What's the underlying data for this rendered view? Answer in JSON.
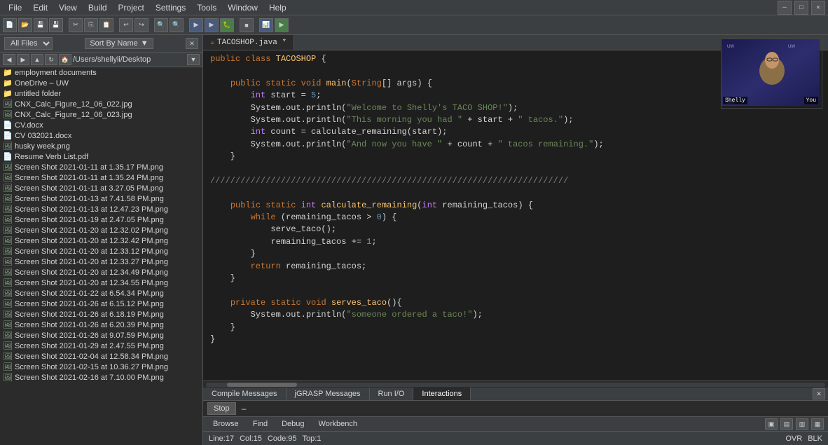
{
  "menuBar": {
    "items": [
      "File",
      "Edit",
      "View",
      "Build",
      "Project",
      "Settings",
      "Tools",
      "Window",
      "Help"
    ]
  },
  "toolbar": {
    "buttons": [
      "new",
      "open",
      "save",
      "saveall",
      "sep",
      "cut",
      "copy",
      "paste",
      "sep",
      "undo",
      "redo",
      "sep",
      "compile",
      "run",
      "debug",
      "sep",
      "stop",
      "sep",
      "browse"
    ]
  },
  "sidebar": {
    "allFilesLabel": "All Files",
    "sortByLabel": "Sort By Name",
    "path": "/Users/shellyli/Desktop",
    "files": [
      {
        "name": "employment documents",
        "type": "folder"
      },
      {
        "name": "OneDrive – UW",
        "type": "folder"
      },
      {
        "name": "untitled folder",
        "type": "folder"
      },
      {
        "name": "CNX_Calc_Figure_12_06_022.jpg",
        "type": "jpg"
      },
      {
        "name": "CNX_Calc_Figure_12_06_023.jpg",
        "type": "jpg"
      },
      {
        "name": "CV.docx",
        "type": "docx"
      },
      {
        "name": "CV 032021.docx",
        "type": "docx"
      },
      {
        "name": "husky week.png",
        "type": "png"
      },
      {
        "name": "Resume Verb List.pdf",
        "type": "pdf"
      },
      {
        "name": "Screen Shot 2021-01-11 at 1.35.17 PM.png",
        "type": "png"
      },
      {
        "name": "Screen Shot 2021-01-11 at 1.35.24 PM.png",
        "type": "png"
      },
      {
        "name": "Screen Shot 2021-01-11 at 3.27.05 PM.png",
        "type": "png"
      },
      {
        "name": "Screen Shot 2021-01-13 at 7.41.58 PM.png",
        "type": "png"
      },
      {
        "name": "Screen Shot 2021-01-13 at 12.47.23 PM.png",
        "type": "png"
      },
      {
        "name": "Screen Shot 2021-01-19 at 2.47.05 PM.png",
        "type": "png"
      },
      {
        "name": "Screen Shot 2021-01-20 at 12.32.02 PM.png",
        "type": "png"
      },
      {
        "name": "Screen Shot 2021-01-20 at 12.32.42 PM.png",
        "type": "png"
      },
      {
        "name": "Screen Shot 2021-01-20 at 12.33.12 PM.png",
        "type": "png"
      },
      {
        "name": "Screen Shot 2021-01-20 at 12.33.27 PM.png",
        "type": "png"
      },
      {
        "name": "Screen Shot 2021-01-20 at 12.34.49 PM.png",
        "type": "png"
      },
      {
        "name": "Screen Shot 2021-01-20 at 12.34.55 PM.png",
        "type": "png"
      },
      {
        "name": "Screen Shot 2021-01-22 at 6.54.34 PM.png",
        "type": "png"
      },
      {
        "name": "Screen Shot 2021-01-26 at 6.15.12 PM.png",
        "type": "png"
      },
      {
        "name": "Screen Shot 2021-01-26 at 6.18.19 PM.png",
        "type": "png"
      },
      {
        "name": "Screen Shot 2021-01-26 at 6.20.39 PM.png",
        "type": "png"
      },
      {
        "name": "Screen Shot 2021-01-26 at 9.07.59 PM.png",
        "type": "png"
      },
      {
        "name": "Screen Shot 2021-01-29 at 2.47.55 PM.png",
        "type": "png"
      },
      {
        "name": "Screen Shot 2021-02-04 at 12.58.34 PM.png",
        "type": "png"
      },
      {
        "name": "Screen Shot 2021-02-15 at 10.36.27 PM.png",
        "type": "png"
      },
      {
        "name": "Screen Shot 2021-02-16 at 7.10.00 PM.png",
        "type": "png"
      }
    ]
  },
  "editor": {
    "filename": "TACOSHOP.java *",
    "code": "public class TACOSHOP {"
  },
  "bottomTabs": {
    "tabs": [
      "Compile Messages",
      "jGRASP Messages",
      "Run I/O",
      "Interactions"
    ],
    "activeTab": "Interactions",
    "stopLabel": "Stop",
    "dashLabel": "–"
  },
  "bottomNav": {
    "buttons": [
      "Browse",
      "Find",
      "Debug",
      "Workbench"
    ]
  },
  "statusBar": {
    "line": "Line:17",
    "col": "Col:15",
    "code": "Code:95",
    "top": "Top:1",
    "ovr": "OVR",
    "blk": "BLK"
  },
  "video": {
    "name1": "Shelly",
    "name2": "You"
  }
}
